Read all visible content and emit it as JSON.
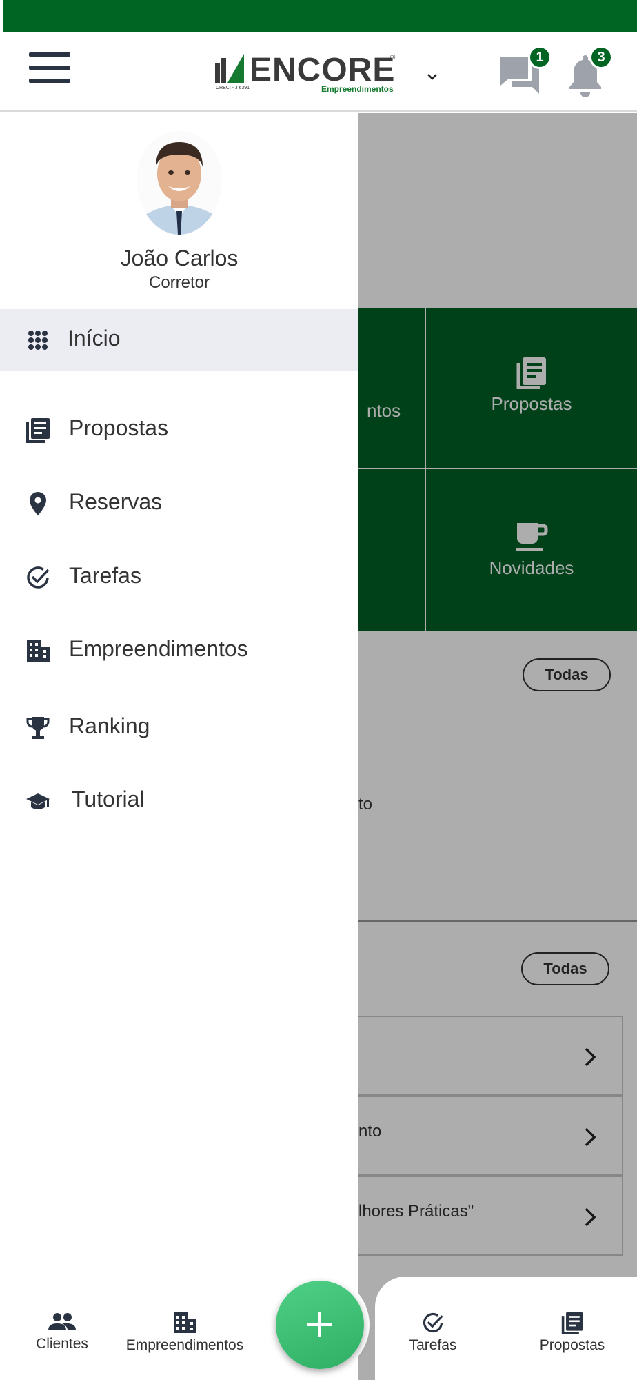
{
  "header": {
    "logo_text": "ENCORE",
    "logo_registered": "®",
    "logo_subtitle": "Empreendimentos",
    "logo_creci": "CRECI - J 6391",
    "messages_count": "1",
    "notifications_count": "3"
  },
  "drawer": {
    "user_name": "João Carlos",
    "user_role": "Corretor",
    "menu": [
      {
        "label": "Início",
        "icon": "grid-icon",
        "active": true
      },
      {
        "label": "Propostas",
        "icon": "document-icon"
      },
      {
        "label": "Reservas",
        "icon": "location-pin-icon"
      },
      {
        "label": "Tarefas",
        "icon": "check-circle-icon"
      },
      {
        "label": "Empreendimentos",
        "icon": "building-icon"
      },
      {
        "label": "Ranking",
        "icon": "trophy-icon"
      },
      {
        "label": "Tutorial",
        "icon": "graduation-cap-icon"
      }
    ]
  },
  "background": {
    "tile_a_fragment": "ntos",
    "tile_propostas": "Propostas",
    "tile_novidades": "Novidades",
    "todas_1": "Todas",
    "todas_2": "Todas",
    "fragment_to": "to",
    "list_fragments": [
      "",
      "nto",
      "lhores Práticas\""
    ]
  },
  "bottom_nav": {
    "clientes": "Clientes",
    "empreendimentos": "Empreendimentos",
    "tarefas": "Tarefas",
    "propostas": "Propostas"
  },
  "colors": {
    "brand_green": "#006523",
    "tile_green": "#006127",
    "fab_green": "#3cc074",
    "text_dark": "#333333"
  }
}
